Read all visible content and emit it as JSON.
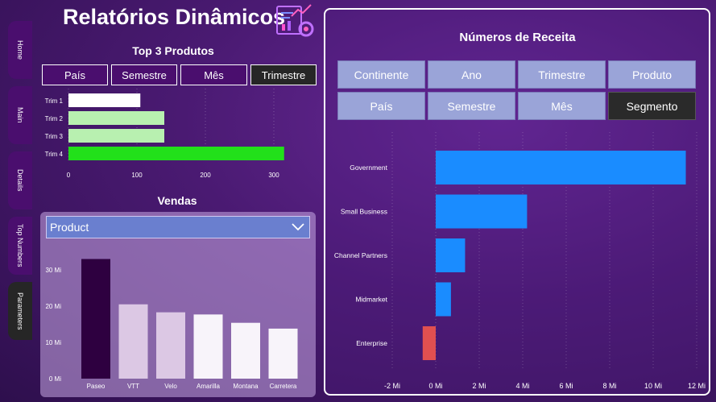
{
  "title": "Relatórios Dinâmicos",
  "nav": [
    "Home",
    "Main",
    "Details",
    "Top Numbers",
    "Parameters"
  ],
  "top3": {
    "title": "Top 3 Produtos",
    "buttons": [
      "País",
      "Semestre",
      "Mês",
      "Trimestre"
    ],
    "active_button": "Trimestre"
  },
  "vendas": {
    "title": "Vendas",
    "dropdown": "Product"
  },
  "receita": {
    "title": "Números de Receita",
    "buttons": [
      "Continente",
      "Ano",
      "Trimestre",
      "Produto",
      "País",
      "Semestre",
      "Mês",
      "Segmento"
    ],
    "active_button": "Segmento"
  },
  "chart_data": [
    {
      "type": "bar",
      "orientation": "horizontal",
      "categories": [
        "Trim 1",
        "Trim 2",
        "Trim 3",
        "Trim 4"
      ],
      "values": [
        105,
        140,
        140,
        315
      ],
      "colors": [
        "#ffffff",
        "#b8f0b0",
        "#b8f0b0",
        "#22e01a"
      ],
      "xticks": [
        "0",
        "100",
        "200",
        "300"
      ],
      "xlim": [
        0,
        340
      ]
    },
    {
      "type": "bar",
      "categories": [
        "Paseo",
        "VTT",
        "Velo",
        "Amarilla",
        "Montana",
        "Carretera"
      ],
      "values": [
        33,
        20.5,
        18.3,
        17.7,
        15.4,
        13.8
      ],
      "colors": [
        "#2e0040",
        "#dcc8e4",
        "#dcc8e4",
        "#f8f4fa",
        "#f8f4fa",
        "#f8f4fa"
      ],
      "yticks": [
        "0 Mi",
        "10 Mi",
        "20 Mi",
        "30 Mi"
      ],
      "ylim": [
        0,
        36
      ],
      "unit": "Mi"
    },
    {
      "type": "bar",
      "orientation": "horizontal",
      "categories": [
        "Government",
        "Small Business",
        "Channel Partners",
        "Midmarket",
        "Enterprise"
      ],
      "values": [
        11.5,
        4.2,
        1.35,
        0.7,
        -0.6
      ],
      "colors": [
        "#1a8cff",
        "#1a8cff",
        "#1a8cff",
        "#1a8cff",
        "#e05050"
      ],
      "xticks": [
        "-2 Mi",
        "0 Mi",
        "2 Mi",
        "4 Mi",
        "6 Mi",
        "8 Mi",
        "10 Mi",
        "12 Mi"
      ],
      "xlim": [
        -2,
        12
      ],
      "unit": "Mi"
    }
  ]
}
